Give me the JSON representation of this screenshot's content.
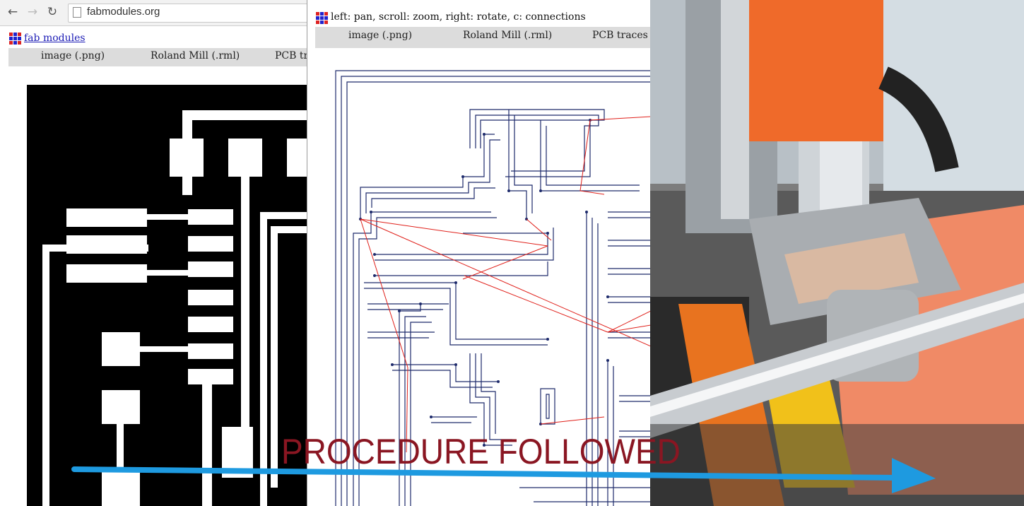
{
  "browser": {
    "url": "fabmodules.org",
    "nav": {
      "back_icon": "arrow-left-icon",
      "forward_icon": "arrow-right-icon",
      "reload_icon": "reload-icon"
    },
    "site_link": "fab modules",
    "menu": [
      "image (.png)",
      "Roland Mill (.rml)",
      "PCB tr"
    ]
  },
  "viewer": {
    "hint": "left: pan, scroll: zoom, right: rotate, c: connections",
    "menu": [
      "image (.png)",
      "Roland Mill (.rml)",
      "PCB traces ("
    ]
  },
  "caption": "PROCEDURE FOLLOWED",
  "colors": {
    "arrow": "#1e9ae0",
    "caption": "#8a1622",
    "toolpath": "#1d2a6b",
    "connections": "#e0201a",
    "machine": "#f06a2a"
  }
}
